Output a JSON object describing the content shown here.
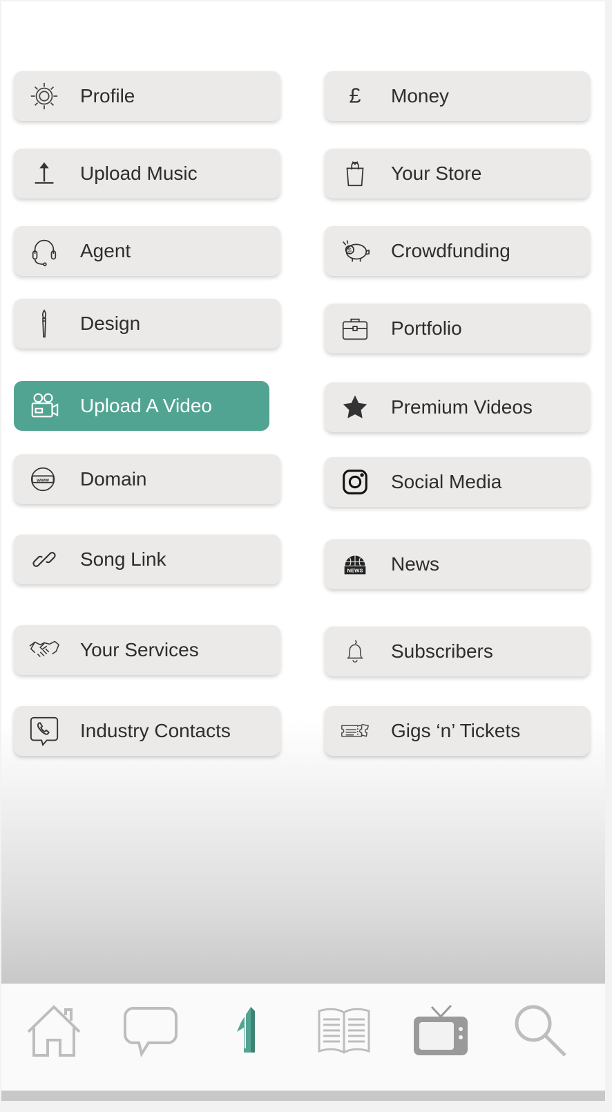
{
  "menu": {
    "left": [
      {
        "label": "Profile",
        "icon": "gear-icon"
      },
      {
        "label": "Upload Music",
        "icon": "upload-icon"
      },
      {
        "label": "Agent",
        "icon": "headset-icon"
      },
      {
        "label": "Design",
        "icon": "paintbrush-icon"
      },
      {
        "label": "Upload A Video",
        "icon": "video-camera-icon",
        "active": true
      },
      {
        "label": "Domain",
        "icon": "www-globe-icon"
      },
      {
        "label": "Song Link",
        "icon": "link-icon"
      },
      {
        "label": "Your Services",
        "icon": "handshake-icon"
      },
      {
        "label": "Industry Contacts",
        "icon": "phone-chat-icon"
      }
    ],
    "right": [
      {
        "label": "Money",
        "icon": "pound-icon"
      },
      {
        "label": "Your Store",
        "icon": "shopping-bag-icon"
      },
      {
        "label": "Crowdfunding",
        "icon": "piggy-bank-icon"
      },
      {
        "label": "Portfolio",
        "icon": "briefcase-icon"
      },
      {
        "label": "Premium Videos",
        "icon": "star-icon"
      },
      {
        "label": "Social Media",
        "icon": "instagram-icon"
      },
      {
        "label": "News",
        "icon": "news-globe-icon"
      },
      {
        "label": "Subscribers",
        "icon": "bell-icon"
      },
      {
        "label": "Gigs ‘n’ Tickets",
        "icon": "ticket-icon"
      }
    ]
  },
  "bottom_nav": [
    "home-icon",
    "chat-icon",
    "logo-icon",
    "book-icon",
    "tv-icon",
    "search-icon"
  ],
  "colors": {
    "accent": "#52a492",
    "button_bg": "#ebeae8",
    "text": "#2d2d2d",
    "nav_icon": "#bdbdbd"
  }
}
